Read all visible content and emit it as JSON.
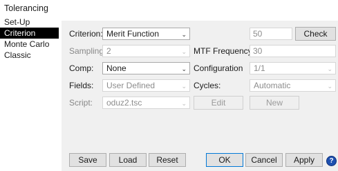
{
  "window": {
    "title": "Tolerancing"
  },
  "sidebar": {
    "items": [
      {
        "label": "Set-Up"
      },
      {
        "label": "Criterion"
      },
      {
        "label": "Monte Carlo"
      },
      {
        "label": "Classic"
      }
    ]
  },
  "form": {
    "criterion": {
      "label": "Criterion:",
      "value": "Merit Function"
    },
    "criterion_value": "50",
    "check_label": "Check",
    "sampling": {
      "label": "Sampling:",
      "value": "2"
    },
    "mtf_frequency": {
      "label": "MTF Frequency:",
      "value": "30"
    },
    "comp": {
      "label": "Comp:",
      "value": "None"
    },
    "configuration": {
      "label": "Configuration",
      "value": "1/1"
    },
    "fields": {
      "label": "Fields:",
      "value": "User Defined"
    },
    "cycles": {
      "label": "Cycles:",
      "value": "Automatic"
    },
    "script": {
      "label": "Script:",
      "value": "oduz2.tsc"
    },
    "edit_label": "Edit",
    "new_label": "New"
  },
  "footer": {
    "save_label": "Save",
    "load_label": "Load",
    "reset_label": "Reset",
    "ok_label": "OK",
    "cancel_label": "Cancel",
    "apply_label": "Apply",
    "help_icon": "help-icon",
    "help_glyph": "?"
  }
}
